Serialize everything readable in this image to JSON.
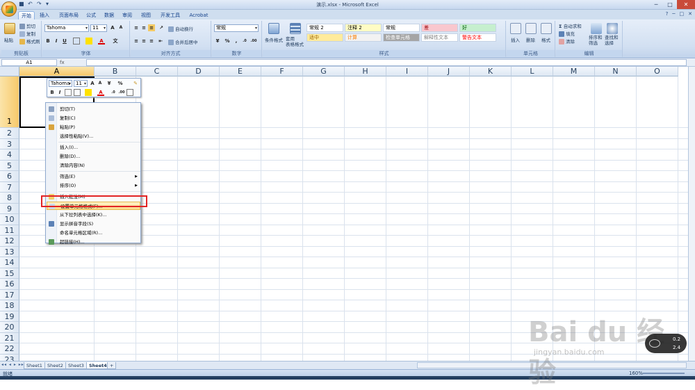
{
  "window": {
    "title": "演示.xlsx - Microsoft Excel"
  },
  "qat": {
    "save_icon": "save-icon",
    "undo_icon": "undo-icon",
    "redo_icon": "redo-icon"
  },
  "tabs": [
    "开始",
    "插入",
    "页面布局",
    "公式",
    "数据",
    "审阅",
    "视图",
    "开发工具",
    "Acrobat"
  ],
  "ribbon": {
    "clipboard": {
      "paste": "粘贴",
      "cut": "剪切",
      "copy": "复制",
      "format_painter": "格式刷",
      "label": "剪贴板"
    },
    "font": {
      "font_name": "Tahoma",
      "font_size": "11",
      "label": "字体"
    },
    "alignment": {
      "wrap": "自动换行",
      "merge": "合并后居中",
      "label": "对齐方式"
    },
    "number": {
      "format": "常规",
      "label": "数字"
    },
    "styles": {
      "conditional": "条件格式",
      "table_format": "套用\n表格格式",
      "cells": [
        {
          "text": "常规 2",
          "bg": "#ffffff",
          "fg": "#000000"
        },
        {
          "text": "注释 2",
          "bg": "#fffcc4",
          "fg": "#000000"
        },
        {
          "text": "常规",
          "bg": "#ffffff",
          "fg": "#000000"
        },
        {
          "text": "差",
          "bg": "#f9c7ce",
          "fg": "#9c0006"
        },
        {
          "text": "好",
          "bg": "#c6efce",
          "fg": "#006100"
        },
        {
          "text": "适中",
          "bg": "#ffeb9c",
          "fg": "#9c6500"
        },
        {
          "text": "计算",
          "bg": "#f2f2f2",
          "fg": "#fa7d00"
        },
        {
          "text": "检查单元格",
          "bg": "#a5a5a5",
          "fg": "#ffffff"
        },
        {
          "text": "解释性文本",
          "bg": "#ffffff",
          "fg": "#7f7f7f"
        },
        {
          "text": "警告文本",
          "bg": "#ffffff",
          "fg": "#ff0000"
        }
      ],
      "label": "样式"
    },
    "cells_group": {
      "insert": "插入",
      "delete": "删除",
      "format": "格式",
      "label": "单元格"
    },
    "editing": {
      "autosum": "自动求和",
      "fill": "填充",
      "clear": "清除",
      "sort": "排序和\n筛选",
      "find": "查找和\n选择",
      "label": "编辑"
    }
  },
  "formula_bar": {
    "name_box": "A1",
    "fx": "fx",
    "value": ""
  },
  "columns": [
    "A",
    "B",
    "C",
    "D",
    "E",
    "F",
    "G",
    "H",
    "I",
    "J",
    "K",
    "L",
    "M",
    "N",
    "O"
  ],
  "rows": [
    "1",
    "2",
    "3",
    "4",
    "5",
    "6",
    "7",
    "8",
    "9",
    "10",
    "11",
    "12",
    "13",
    "14",
    "15",
    "16",
    "17",
    "18",
    "19",
    "20",
    "21",
    "22",
    "23"
  ],
  "selected_cell": "A1",
  "mini_toolbar": {
    "font": "Tahoma",
    "size": "11",
    "percent": "%"
  },
  "context_menu": [
    {
      "label": "剪切(T)",
      "icon": "scissors-icon",
      "hasIcon": true
    },
    {
      "label": "复制(C)",
      "icon": "copy-icon",
      "hasIcon": true
    },
    {
      "label": "粘贴(P)",
      "icon": "paste-icon",
      "hasIcon": true
    },
    {
      "label": "选择性粘贴(V)...",
      "icon": "",
      "hasIcon": false
    },
    {
      "sep": true
    },
    {
      "label": "插入(I)...",
      "icon": "",
      "hasIcon": false
    },
    {
      "label": "删除(D)...",
      "icon": "",
      "hasIcon": false
    },
    {
      "label": "清除内容(N)",
      "icon": "",
      "hasIcon": false
    },
    {
      "sep": true
    },
    {
      "label": "筛选(E)",
      "icon": "",
      "hasIcon": false,
      "submenu": true
    },
    {
      "label": "排序(O)",
      "icon": "",
      "hasIcon": false,
      "submenu": true
    },
    {
      "sep": true
    },
    {
      "label": "插入批注(M)",
      "icon": "comment-icon",
      "hasIcon": true
    },
    {
      "label": "设置单元格格式(F)...",
      "icon": "format-cells-icon",
      "hasIcon": true,
      "highlighted": true
    },
    {
      "label": "从下拉列表中选择(K)...",
      "icon": "",
      "hasIcon": false
    },
    {
      "label": "显示拼音字段(S)",
      "icon": "phonetic-icon",
      "hasIcon": true
    },
    {
      "label": "命名单元格区域(R)...",
      "icon": "",
      "hasIcon": false
    },
    {
      "label": "超链接(H)...",
      "icon": "hyperlink-icon",
      "hasIcon": true
    }
  ],
  "sheets": [
    "Sheet1",
    "Sheet2",
    "Sheet3",
    "Sheet4"
  ],
  "active_sheet": "Sheet4",
  "status": {
    "text": "就绪",
    "zoom": "160%"
  },
  "watermark": {
    "main": "Bai du 经验",
    "sub": "jingyan.baidu.com"
  },
  "gadget": {
    "line1": "0.2",
    "line2": "2.4"
  }
}
